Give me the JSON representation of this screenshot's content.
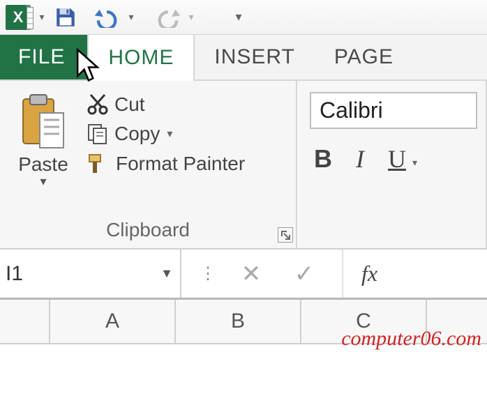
{
  "qat": {
    "excel_letter": "X"
  },
  "tabs": {
    "file": "FILE",
    "home": "HOME",
    "insert": "INSERT",
    "page": "PAGE"
  },
  "clipboard": {
    "group_label": "Clipboard",
    "paste": "Paste",
    "cut": "Cut",
    "copy": "Copy",
    "format_painter": "Format Painter"
  },
  "font": {
    "name": "Calibri",
    "bold": "B",
    "italic": "I",
    "underline": "U"
  },
  "name_box": {
    "value": "I1"
  },
  "formula_bar": {
    "fx": "fx"
  },
  "columns": [
    "A",
    "B",
    "C"
  ],
  "watermark": "computer06.com"
}
